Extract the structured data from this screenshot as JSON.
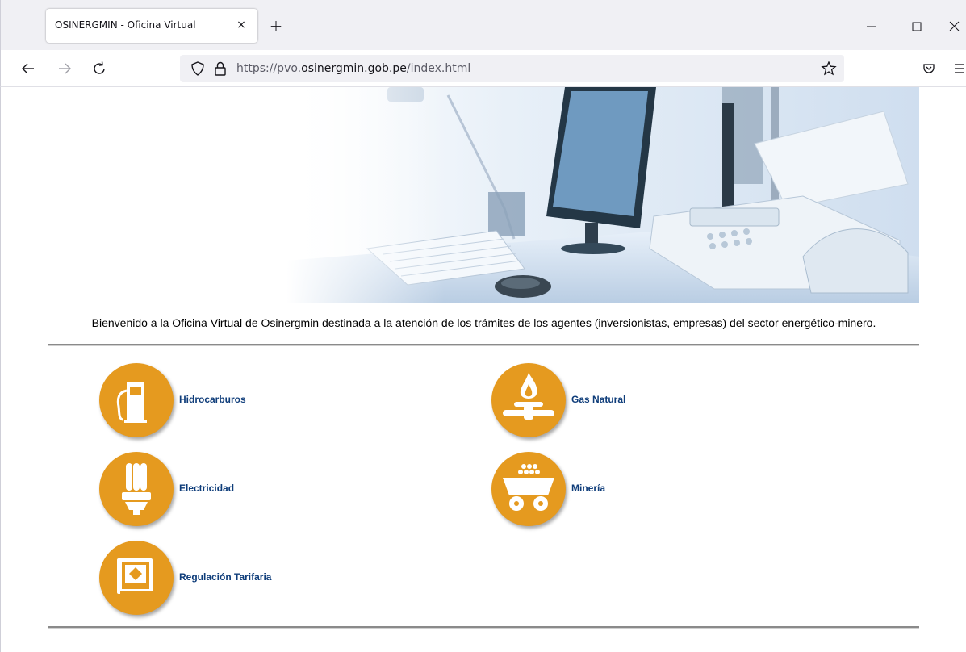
{
  "browser": {
    "tab_title": "OSINERGMIN - Oficina Virtual",
    "tab_close": "×",
    "new_tab": "+",
    "url_prefix": "https://pvo.",
    "url_domain": "osinergmin.gob.pe",
    "url_path": "/index.html"
  },
  "page": {
    "welcome_text": "Bienvenido a la Oficina Virtual de Osinergmin destinada a la atención de los trámites de los agentes (inversionistas, empresas) del sector energético-minero.",
    "accent_color": "#e59a1f",
    "link_color": "#0f3d7a",
    "services": [
      {
        "label": "Hidrocarburos",
        "icon": "fuel-pump-icon"
      },
      {
        "label": "Gas Natural",
        "icon": "gas-flame-icon"
      },
      {
        "label": "Electricidad",
        "icon": "light-bulb-icon"
      },
      {
        "label": "Minería",
        "icon": "mine-cart-icon"
      },
      {
        "label": "Regulación Tarifaria",
        "icon": "regulation-book-icon"
      }
    ]
  }
}
